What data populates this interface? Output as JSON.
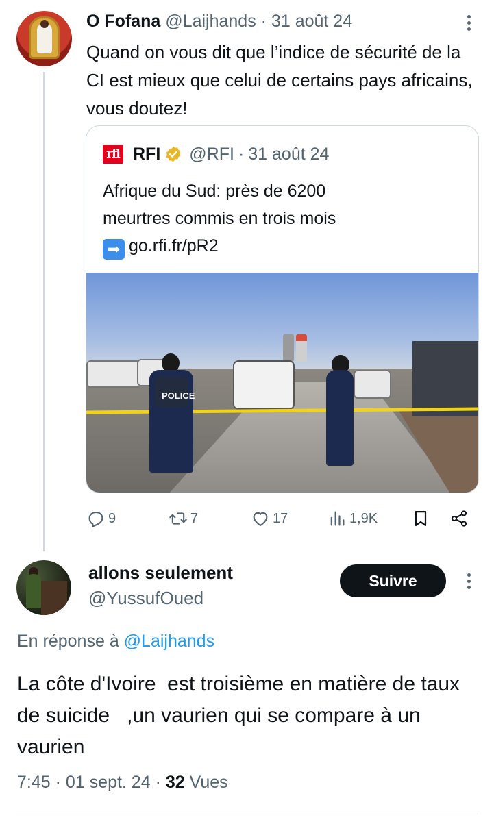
{
  "parent_tweet": {
    "display_name": "O Fofana",
    "handle": "@Laijhands",
    "separator": "·",
    "date": "31 août 24",
    "text": "Quand on vous dit que l’indice de sécurité de la CI est mieux que celui de certains pays africains, vous doutez!",
    "quoted": {
      "logo_text": "rfi",
      "display_name": "RFI",
      "handle": "@RFI",
      "separator": "·",
      "date": "31 août 24",
      "text_line1": "Afrique du Sud: près de 6200",
      "text_line2": "meurtres commis en trois mois",
      "link": "go.rfi.fr/pR2",
      "arrow_emoji": "➡",
      "photo_vest_label": "POLICE"
    },
    "actions": {
      "replies": "9",
      "reposts": "7",
      "likes": "17",
      "views": "1,9K"
    }
  },
  "reply": {
    "display_name": "allons seulement",
    "handle": "@YussufOued",
    "follow_label": "Suivre",
    "reply_prefix": "En réponse à",
    "reply_mention": "@Laijhands",
    "text": "La côte d'Ivoire  est troisième en matière de taux de suicide   ,un vaurien qui se compare à un vaurien",
    "time": "7:45",
    "date": "01 sept. 24",
    "views_count": "32",
    "views_label": "Vues",
    "separator": "·"
  },
  "colors": {
    "text_primary": "#0f1419",
    "text_secondary": "#536471",
    "link": "#1d9bf0",
    "follow_button": "#0f1419",
    "rfi_red": "#e2001a",
    "verified_gold": "#e8b829"
  },
  "icons": [
    "more-icon",
    "verified-gold-icon",
    "reply-icon",
    "repost-icon",
    "like-icon",
    "views-icon",
    "bookmark-icon",
    "share-icon"
  ]
}
